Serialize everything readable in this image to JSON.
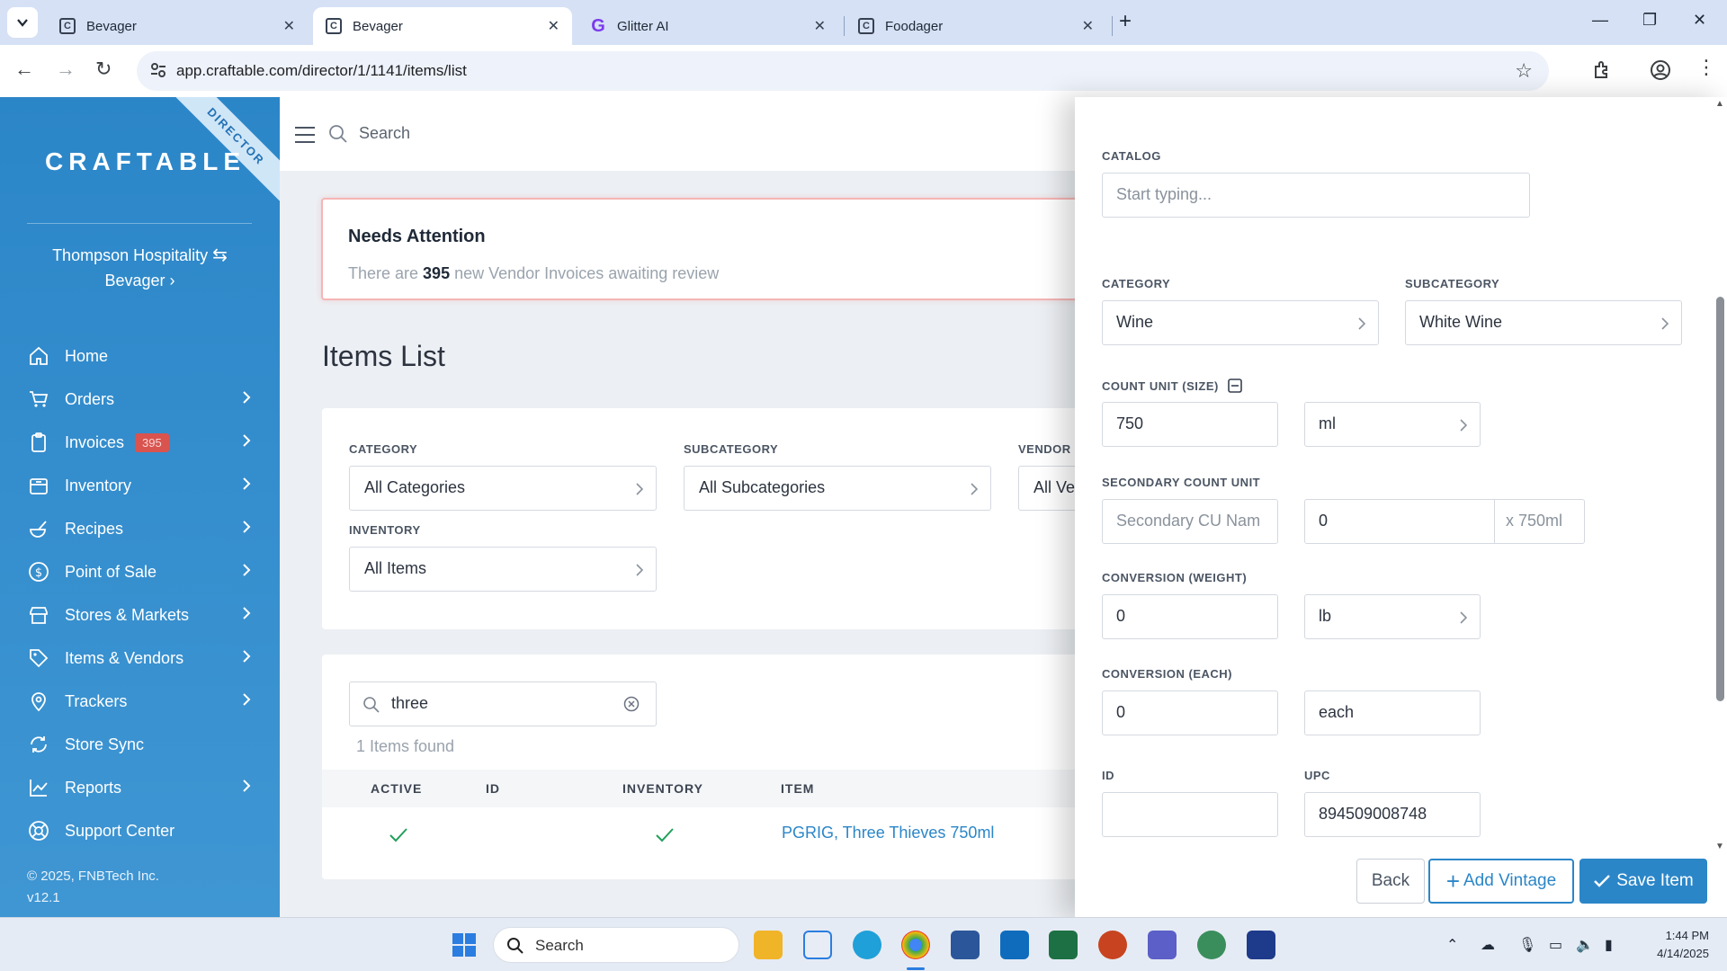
{
  "browser": {
    "tabs": [
      {
        "title": "Bevager",
        "active": false
      },
      {
        "title": "Bevager",
        "active": true
      },
      {
        "title": "Glitter AI",
        "active": false
      },
      {
        "title": "Foodager",
        "active": false
      }
    ],
    "url": "app.craftable.com/director/1/1141/items/list"
  },
  "sidebar": {
    "ribbon": "DIRECTOR",
    "brand": "CRAFTABLE",
    "org_name": "Thompson Hospitality",
    "org_sub": "Bevager",
    "nav": [
      {
        "label": "Home",
        "icon": "home-icon",
        "chevron": false
      },
      {
        "label": "Orders",
        "icon": "cart-icon",
        "chevron": true
      },
      {
        "label": "Invoices",
        "icon": "clipboard-icon",
        "chevron": true,
        "badge": "395"
      },
      {
        "label": "Inventory",
        "icon": "box-icon",
        "chevron": true
      },
      {
        "label": "Recipes",
        "icon": "recipe-icon",
        "chevron": true
      },
      {
        "label": "Point of Sale",
        "icon": "dollar-icon",
        "chevron": true
      },
      {
        "label": "Stores & Markets",
        "icon": "store-icon",
        "chevron": true
      },
      {
        "label": "Items & Vendors",
        "icon": "tag-icon",
        "chevron": true
      },
      {
        "label": "Trackers",
        "icon": "pin-icon",
        "chevron": true
      },
      {
        "label": "Store Sync",
        "icon": "sync-icon",
        "chevron": false
      },
      {
        "label": "Reports",
        "icon": "chart-icon",
        "chevron": true
      },
      {
        "label": "Support Center",
        "icon": "lifebuoy-icon",
        "chevron": false
      }
    ],
    "copyright": "© 2025, FNBTech Inc.",
    "version": "v12.1"
  },
  "main": {
    "search_placeholder": "Search",
    "attention_title": "Needs Attention",
    "attention_pre": "There are ",
    "attention_count": "395",
    "attention_post": " new Vendor Invoices awaiting review",
    "page_title": "Items List",
    "filters": {
      "category_label": "CATEGORY",
      "category_value": "All Categories",
      "subcategory_label": "SUBCATEGORY",
      "subcategory_value": "All Subcategories",
      "vendor_label": "VENDOR",
      "vendor_value": "All Ve",
      "inventory_label": "INVENTORY",
      "inventory_value": "All Items"
    },
    "search_value": "three",
    "found_text": "1 Items found",
    "columns": [
      "ACTIVE",
      "ID",
      "INVENTORY",
      "ITEM"
    ],
    "row": {
      "item": "PGRIG, Three Thieves 750ml"
    }
  },
  "panel": {
    "catalog_label": "CATALOG",
    "catalog_placeholder": "Start typing...",
    "category_label": "CATEGORY",
    "category_value": "Wine",
    "subcategory_label": "SUBCATEGORY",
    "subcategory_value": "White Wine",
    "count_unit_label": "COUNT UNIT (SIZE)",
    "count_unit_value": "750",
    "count_unit_uom": "ml",
    "secondary_label": "SECONDARY COUNT UNIT",
    "secondary_name_placeholder": "Secondary CU Nam",
    "secondary_qty": "0",
    "secondary_suffix": "x 750ml",
    "weight_label": "CONVERSION (WEIGHT)",
    "weight_value": "0",
    "weight_uom": "lb",
    "each_label": "CONVERSION (EACH)",
    "each_value": "0",
    "each_uom": "each",
    "id_label": "ID",
    "id_value": "",
    "upc_label": "UPC",
    "upc_value": "894509008748",
    "back_label": "Back",
    "add_vintage_label": "Add Vintage",
    "save_label": "Save Item"
  },
  "taskbar": {
    "search_label": "Search",
    "time": "1:44 PM",
    "date": "4/14/2025"
  }
}
